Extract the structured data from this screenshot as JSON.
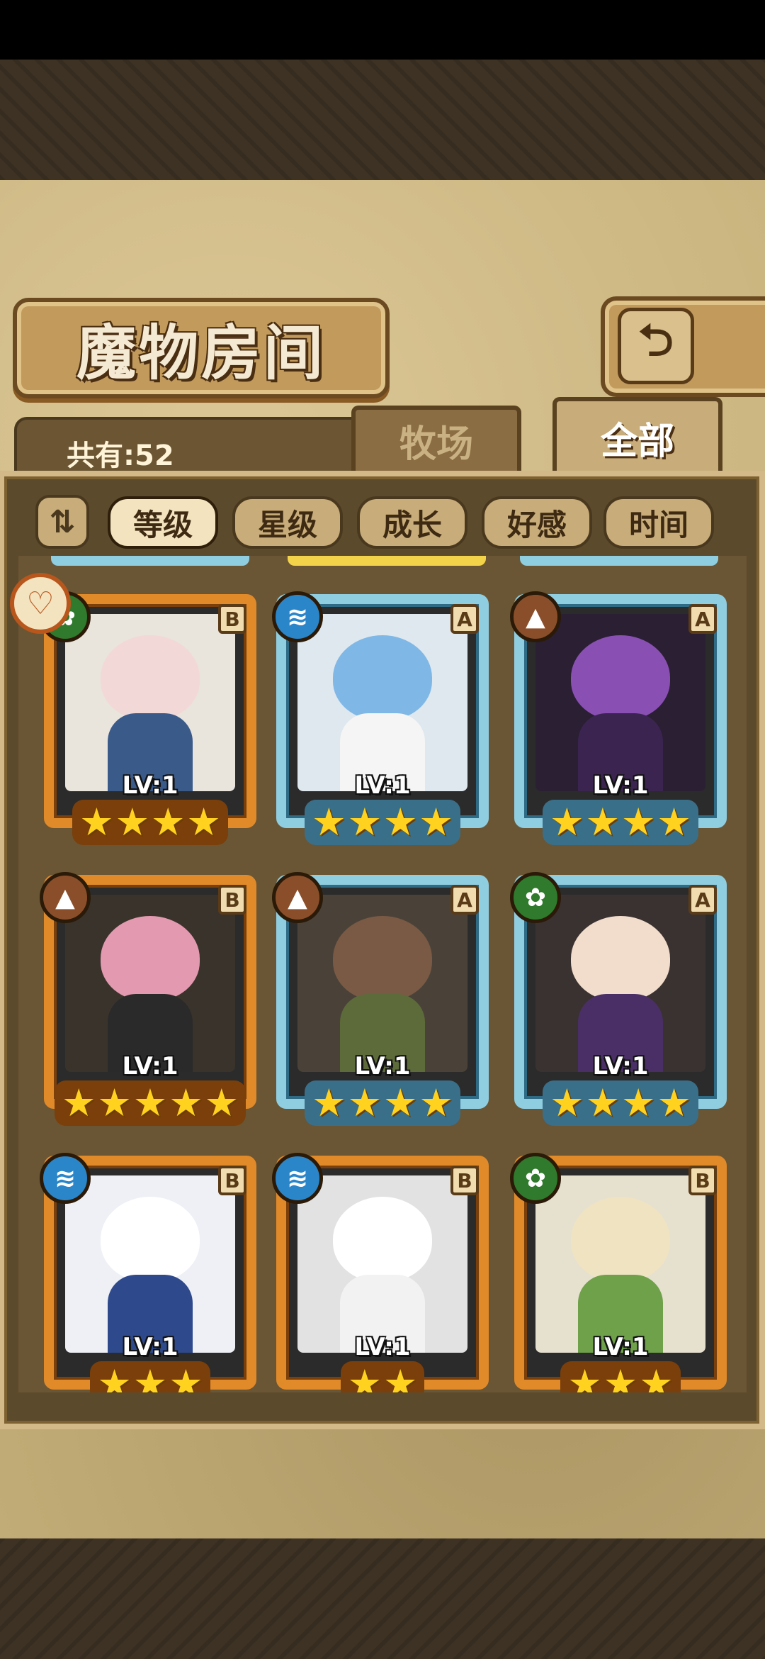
{
  "header": {
    "title": "魔物房间",
    "back_icon": "return-arrow-icon"
  },
  "summary": {
    "count_label": "共有:52"
  },
  "tabs": [
    {
      "label": "牧场",
      "active": false
    },
    {
      "label": "全部",
      "active": true
    }
  ],
  "sort": {
    "toggle_icon": "order-toggle-icon",
    "options": [
      {
        "label": "等级",
        "active": true
      },
      {
        "label": "星级",
        "active": false
      },
      {
        "label": "成长",
        "active": false
      },
      {
        "label": "好感",
        "active": false
      },
      {
        "label": "时间",
        "active": false
      }
    ]
  },
  "monsters": [
    {
      "rank": "B",
      "element": "wood-icon",
      "level": "LV:1",
      "stars": 4
    },
    {
      "rank": "A",
      "element": "water-icon",
      "level": "LV:1",
      "stars": 4
    },
    {
      "rank": "A",
      "element": "earth-icon",
      "level": "LV:1",
      "stars": 4
    },
    {
      "rank": "B",
      "element": "earth-icon",
      "level": "LV:1",
      "stars": 5
    },
    {
      "rank": "A",
      "element": "earth-icon",
      "level": "LV:1",
      "stars": 4
    },
    {
      "rank": "A",
      "element": "wood-icon",
      "level": "LV:1",
      "stars": 4
    },
    {
      "rank": "B",
      "element": "water-icon",
      "level": "LV:1",
      "stars": 3
    },
    {
      "rank": "B",
      "element": "water-icon",
      "level": "LV:1",
      "stars": 2
    },
    {
      "rank": "B",
      "element": "wood-icon",
      "level": "LV:1",
      "stars": 3
    }
  ],
  "colors": {
    "frame_b": "#e08a2a",
    "frame_a": "#8fcde0",
    "star": "#ffd21f",
    "water": "#2a86c9",
    "earth": "#8a4f2a",
    "wood": "#2f7a2c"
  }
}
